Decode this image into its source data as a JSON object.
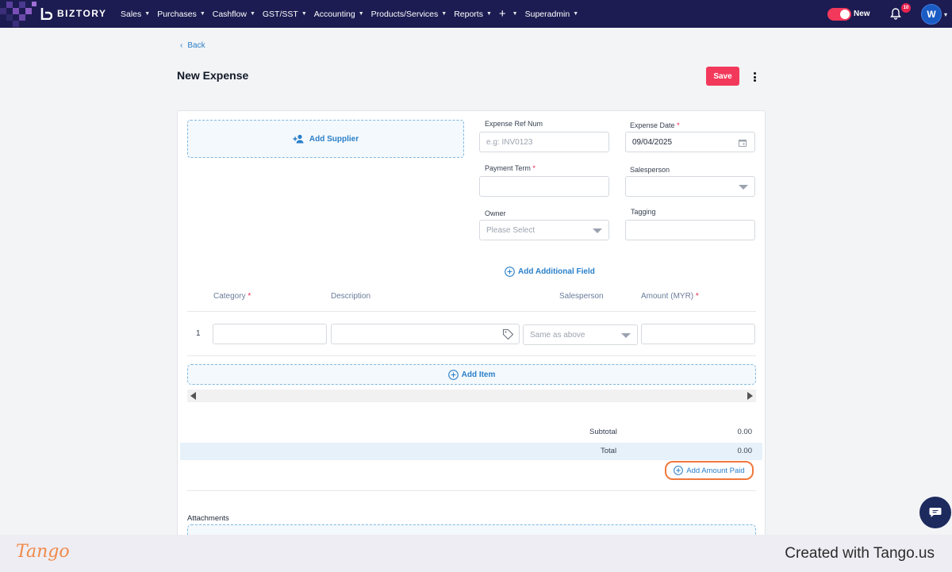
{
  "app": {
    "name": "BIZTORY"
  },
  "nav": {
    "menu": [
      {
        "label": "Sales"
      },
      {
        "label": "Purchases"
      },
      {
        "label": "Cashflow"
      },
      {
        "label": "GST/SST"
      },
      {
        "label": "Accounting"
      },
      {
        "label": "Products/Services"
      },
      {
        "label": "Reports"
      },
      {
        "label": "+"
      },
      {
        "label": "Superadmin"
      }
    ],
    "toggle_label": "New",
    "notification_count": "10",
    "avatar_initial": "W"
  },
  "header": {
    "back_label": "Back",
    "title": "New Expense",
    "save_label": "Save"
  },
  "form": {
    "add_supplier_label": "Add Supplier",
    "expense_ref": {
      "label": "Expense Ref Num",
      "placeholder": "e.g: INV0123",
      "value": ""
    },
    "expense_date": {
      "label": "Expense Date",
      "value": "09/04/2025"
    },
    "payment_term": {
      "label": "Payment Term",
      "value": ""
    },
    "salesperson": {
      "label": "Salesperson",
      "value": ""
    },
    "owner": {
      "label": "Owner",
      "placeholder": "Please Select"
    },
    "tagging": {
      "label": "Tagging",
      "value": ""
    },
    "add_additional_field_label": "Add Additional Field"
  },
  "items": {
    "columns": {
      "category": "Category",
      "description": "Description",
      "salesperson": "Salesperson",
      "amount": "Amount (MYR)"
    },
    "rows": [
      {
        "num": "1",
        "category": "",
        "description": "",
        "salesperson": "Same as above",
        "amount": ""
      }
    ],
    "add_item_label": "Add Item"
  },
  "summary": {
    "subtotal_label": "Subtotal",
    "subtotal_value": "0.00",
    "total_label": "Total",
    "total_value": "0.00",
    "add_amount_paid_label": "Add Amount Paid"
  },
  "attachments": {
    "label": "Attachments"
  },
  "footer": {
    "brand": "Tango",
    "created_with": "Created with Tango.us"
  },
  "colors": {
    "nav_bg": "#1c1c52",
    "accent_red": "#f2395b",
    "link_blue": "#2a7fc9",
    "highlight_orange": "#f0783c"
  }
}
